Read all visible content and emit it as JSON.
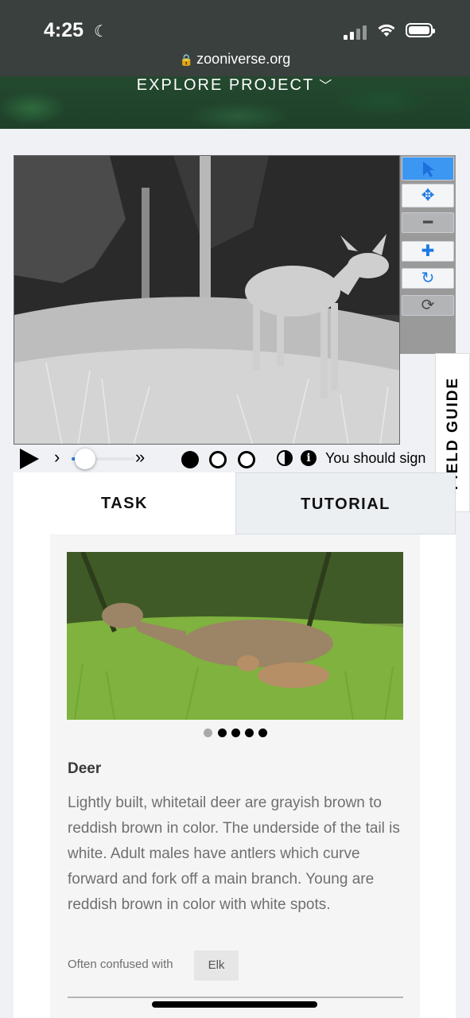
{
  "status_bar": {
    "time": "4:25"
  },
  "browser": {
    "url": "zooniverse.org"
  },
  "header": {
    "explore_label": "EXPLORE PROJECT"
  },
  "viewer": {
    "tools": [
      "pointer-tool",
      "move-tool",
      "zoom-out-tool",
      "zoom-in-tool",
      "rotate-tool",
      "reset-tool"
    ],
    "active_tool": "pointer-tool"
  },
  "field_guide": {
    "label": "FIELD GUIDE"
  },
  "frame_controls": {
    "current_frame": 1,
    "frame_count": 3,
    "signin_text": "You should sign"
  },
  "tabs": [
    {
      "label": "TASK",
      "selected": true
    },
    {
      "label": "TUTORIAL",
      "selected": false
    }
  ],
  "field_guide_entry": {
    "title": "Deer",
    "description": "Lightly built, whitetail deer are grayish brown to reddish brown in color. The underside of the tail is white. Adult males have antlers which curve forward and fork off a main branch. Young are reddish brown in color with white spots.",
    "confused_label": "Often confused with",
    "confused_with": "Elk",
    "image_count": 5,
    "current_image": 1
  },
  "colors": {
    "accent": "#2f7de1",
    "active_tool": "#3c97f3"
  }
}
